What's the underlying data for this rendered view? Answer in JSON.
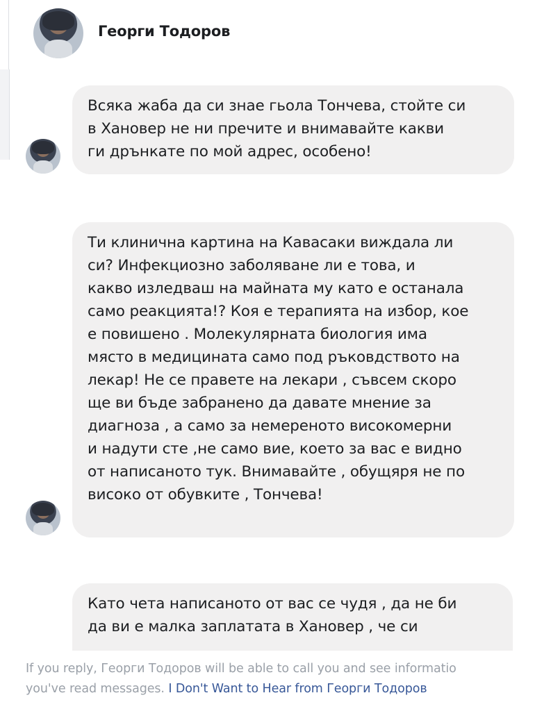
{
  "header": {
    "name": "Георги Тодоров"
  },
  "messages": [
    {
      "text": "Всяка жаба да си знае гьола Тончева, стойте си\nв Хановер не ни пречите и внимавайте какви\nги дрънкате по мой адрес, особено!"
    },
    {
      "text": "Ти клинична картина на Кавасаки виждала ли\nси? Инфекциозно заболяване ли е това, и\nкакво изледваш на майната му като е останала\nсамо реакцията!? Коя е терапията на избор, кое\nе повишено . Молекулярната биология има\nмясто в медицината само под ръковдството на\nлекар! Не се правете на лекари , съвсем скоро\nще ви бъде забранено да давате мнение за\nдиагноза , а само за немереното високомерни\nи надути сте ,не само вие, което за вас е видно\nот написаното тук. Внимавайте , обущяря не по\nвисоко от обувките , Тончева!"
    },
    {
      "text": "Като чета написаното от вас се чудя , да не би\nда ви е малка заплатата в Хановер , че си"
    }
  ],
  "footer": {
    "line1": "If you reply, Георги Тодоров will be able to call you and see informatio",
    "line2_prefix": "you've read messages. ",
    "link": "I Don't Want to Hear from Георги Тодоров"
  }
}
